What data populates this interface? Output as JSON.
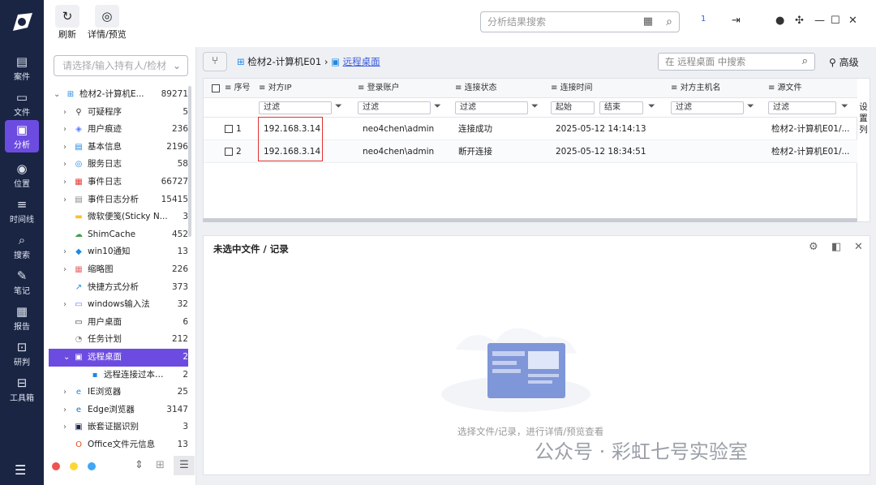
{
  "nav": {
    "items": [
      {
        "label": "案件",
        "icon": "case-icon"
      },
      {
        "label": "文件",
        "icon": "folder-icon"
      },
      {
        "label": "分析",
        "icon": "analysis-icon"
      },
      {
        "label": "位置",
        "icon": "location-icon"
      },
      {
        "label": "时间线",
        "icon": "timeline-icon"
      },
      {
        "label": "搜索",
        "icon": "search-icon"
      },
      {
        "label": "笔记",
        "icon": "note-icon"
      },
      {
        "label": "报告",
        "icon": "report-icon"
      },
      {
        "label": "研判",
        "icon": "judge-icon"
      },
      {
        "label": "工具箱",
        "icon": "toolbox-icon"
      }
    ],
    "active": "分析"
  },
  "toolbar": {
    "refresh_label": "刷新",
    "detail_label": "详情/预览",
    "search_placeholder": "分析结果搜索",
    "badge": "1"
  },
  "sidebar": {
    "search_placeholder": "请选择/输入持有人/检材",
    "root": {
      "label": "检材2-计算机E...",
      "count": "89271"
    },
    "items": [
      {
        "label": "可疑程序",
        "count": "5",
        "arrow": true
      },
      {
        "label": "用户痕迹",
        "count": "236",
        "arrow": true
      },
      {
        "label": "基本信息",
        "count": "2196",
        "arrow": true
      },
      {
        "label": "服务日志",
        "count": "58",
        "arrow": true
      },
      {
        "label": "事件日志",
        "count": "66727",
        "arrow": true
      },
      {
        "label": "事件日志分析",
        "count": "15415",
        "arrow": true
      },
      {
        "label": "微软便笺(Sticky N...",
        "count": "3",
        "arrow": false
      },
      {
        "label": "ShimCache",
        "count": "452",
        "arrow": false
      },
      {
        "label": "win10通知",
        "count": "13",
        "arrow": true
      },
      {
        "label": "缩略图",
        "count": "226",
        "arrow": true
      },
      {
        "label": "快捷方式分析",
        "count": "373",
        "arrow": false
      },
      {
        "label": "windows输入法",
        "count": "32",
        "arrow": true
      },
      {
        "label": "用户桌面",
        "count": "6",
        "arrow": false
      },
      {
        "label": "任务计划",
        "count": "212",
        "arrow": false
      },
      {
        "label": "远程桌面",
        "count": "2",
        "arrow": true,
        "selected": true
      },
      {
        "label": "远程连接过本机...",
        "count": "2",
        "arrow": false,
        "child": true
      },
      {
        "label": "IE浏览器",
        "count": "25",
        "arrow": true
      },
      {
        "label": "Edge浏览器",
        "count": "3147",
        "arrow": true
      },
      {
        "label": "嵌套证据识别",
        "count": "3",
        "arrow": true
      },
      {
        "label": "Office文件元信息",
        "count": "13",
        "arrow": false
      }
    ]
  },
  "breadcrumb": {
    "root": "检材2-计算机E01",
    "current": "远程桌面"
  },
  "content_search": {
    "placeholder": "在 远程桌面 中搜索",
    "advanced": "高级"
  },
  "table": {
    "columns": [
      "序号",
      "对方IP",
      "登录账户",
      "连接状态",
      "连接时间",
      "对方主机名",
      "源文件"
    ],
    "filter_label": "过滤",
    "time_start": "起始",
    "time_end": "结束",
    "rows": [
      {
        "idx": "1",
        "ip": "192.168.3.14",
        "account": "neo4chen\\admin",
        "status": "连接成功",
        "time": "2025-05-12 14:14:13",
        "host": "",
        "source": "检材2-计算机E01/..."
      },
      {
        "idx": "2",
        "ip": "192.168.3.14",
        "account": "neo4chen\\admin",
        "status": "断开连接",
        "time": "2025-05-12 18:34:51",
        "host": "",
        "source": "检材2-计算机E01/..."
      }
    ],
    "settings_label": "设置列"
  },
  "detail_panel": {
    "title": "未选中文件 / 记录",
    "empty_text": "选择文件/记录，进行详情/预览查看"
  },
  "watermark": "公众号 · 彩虹七号实验室",
  "colors": {
    "nav_bg": "#1a2544",
    "accent": "#6c4ce0",
    "highlight": "#e03131"
  }
}
